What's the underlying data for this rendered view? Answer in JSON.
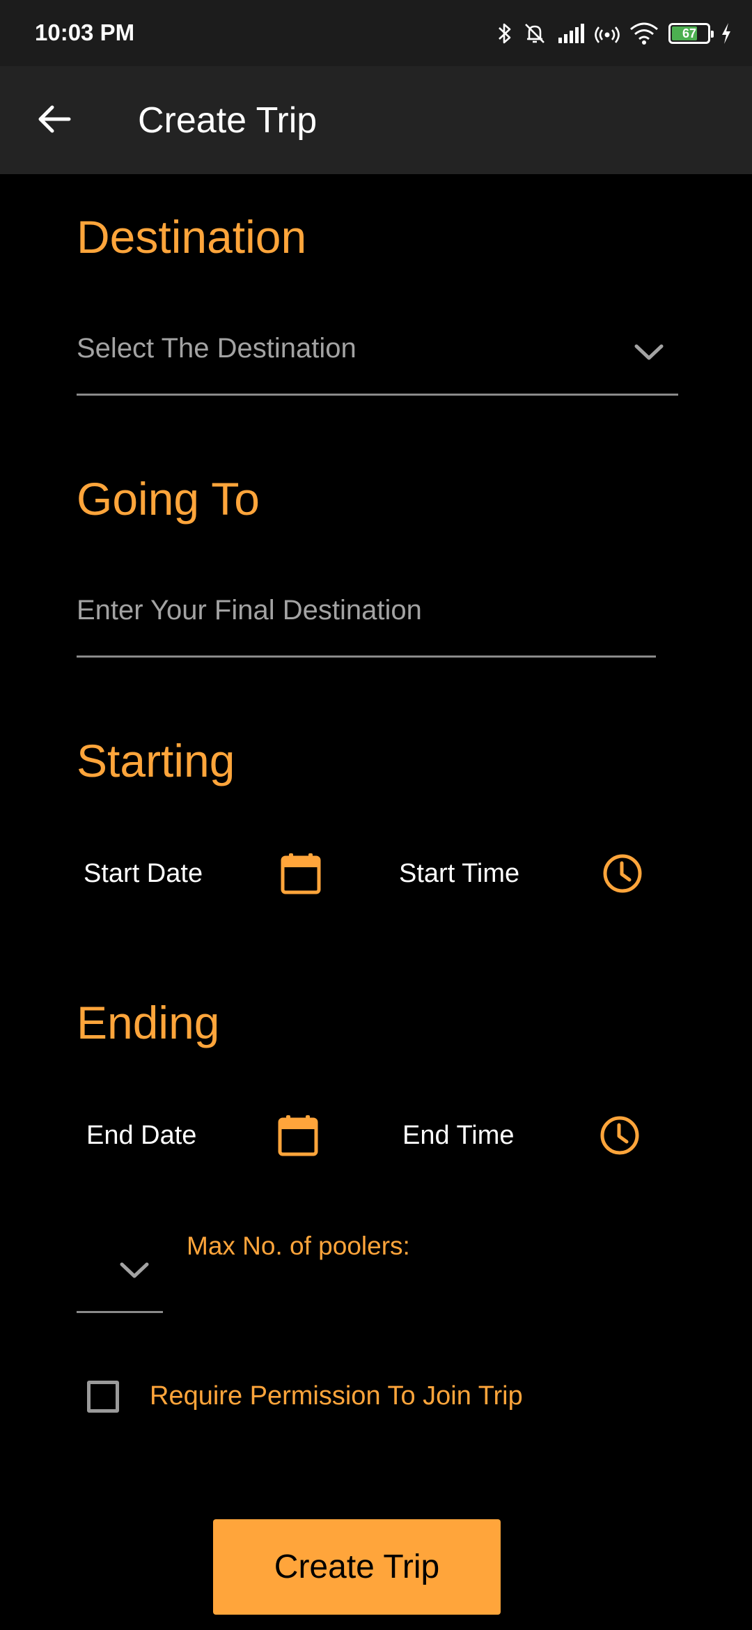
{
  "status_bar": {
    "time": "10:03 PM",
    "battery_level": "67",
    "icons": [
      "bluetooth-icon",
      "mute-bell-icon",
      "signal-icon",
      "hotspot-icon",
      "wifi-icon",
      "battery-icon",
      "charging-icon"
    ]
  },
  "app_bar": {
    "back_icon": "arrow-left-icon",
    "title": "Create Trip"
  },
  "destination": {
    "title": "Destination",
    "placeholder": "Select The Destination",
    "icon": "chevron-down-icon"
  },
  "going_to": {
    "title": "Going To",
    "placeholder": "Enter Your Final Destination"
  },
  "starting": {
    "title": "Starting",
    "date_label": "Start Date",
    "date_icon": "calendar-icon",
    "time_label": "Start Time",
    "time_icon": "clock-icon"
  },
  "ending": {
    "title": "Ending",
    "date_label": "End Date",
    "date_icon": "calendar-icon",
    "time_label": "End Time",
    "time_icon": "clock-icon"
  },
  "poolers": {
    "label": "Max No. of poolers:",
    "value": ""
  },
  "permission": {
    "label": "Require Permission To Join Trip",
    "checked": false
  },
  "submit": {
    "label": "Create Trip"
  },
  "colors": {
    "accent": "#ffa53b",
    "background": "#000000",
    "app_bar": "#232323",
    "status_bar": "#1c1c1c",
    "placeholder": "#a3a3a3"
  }
}
